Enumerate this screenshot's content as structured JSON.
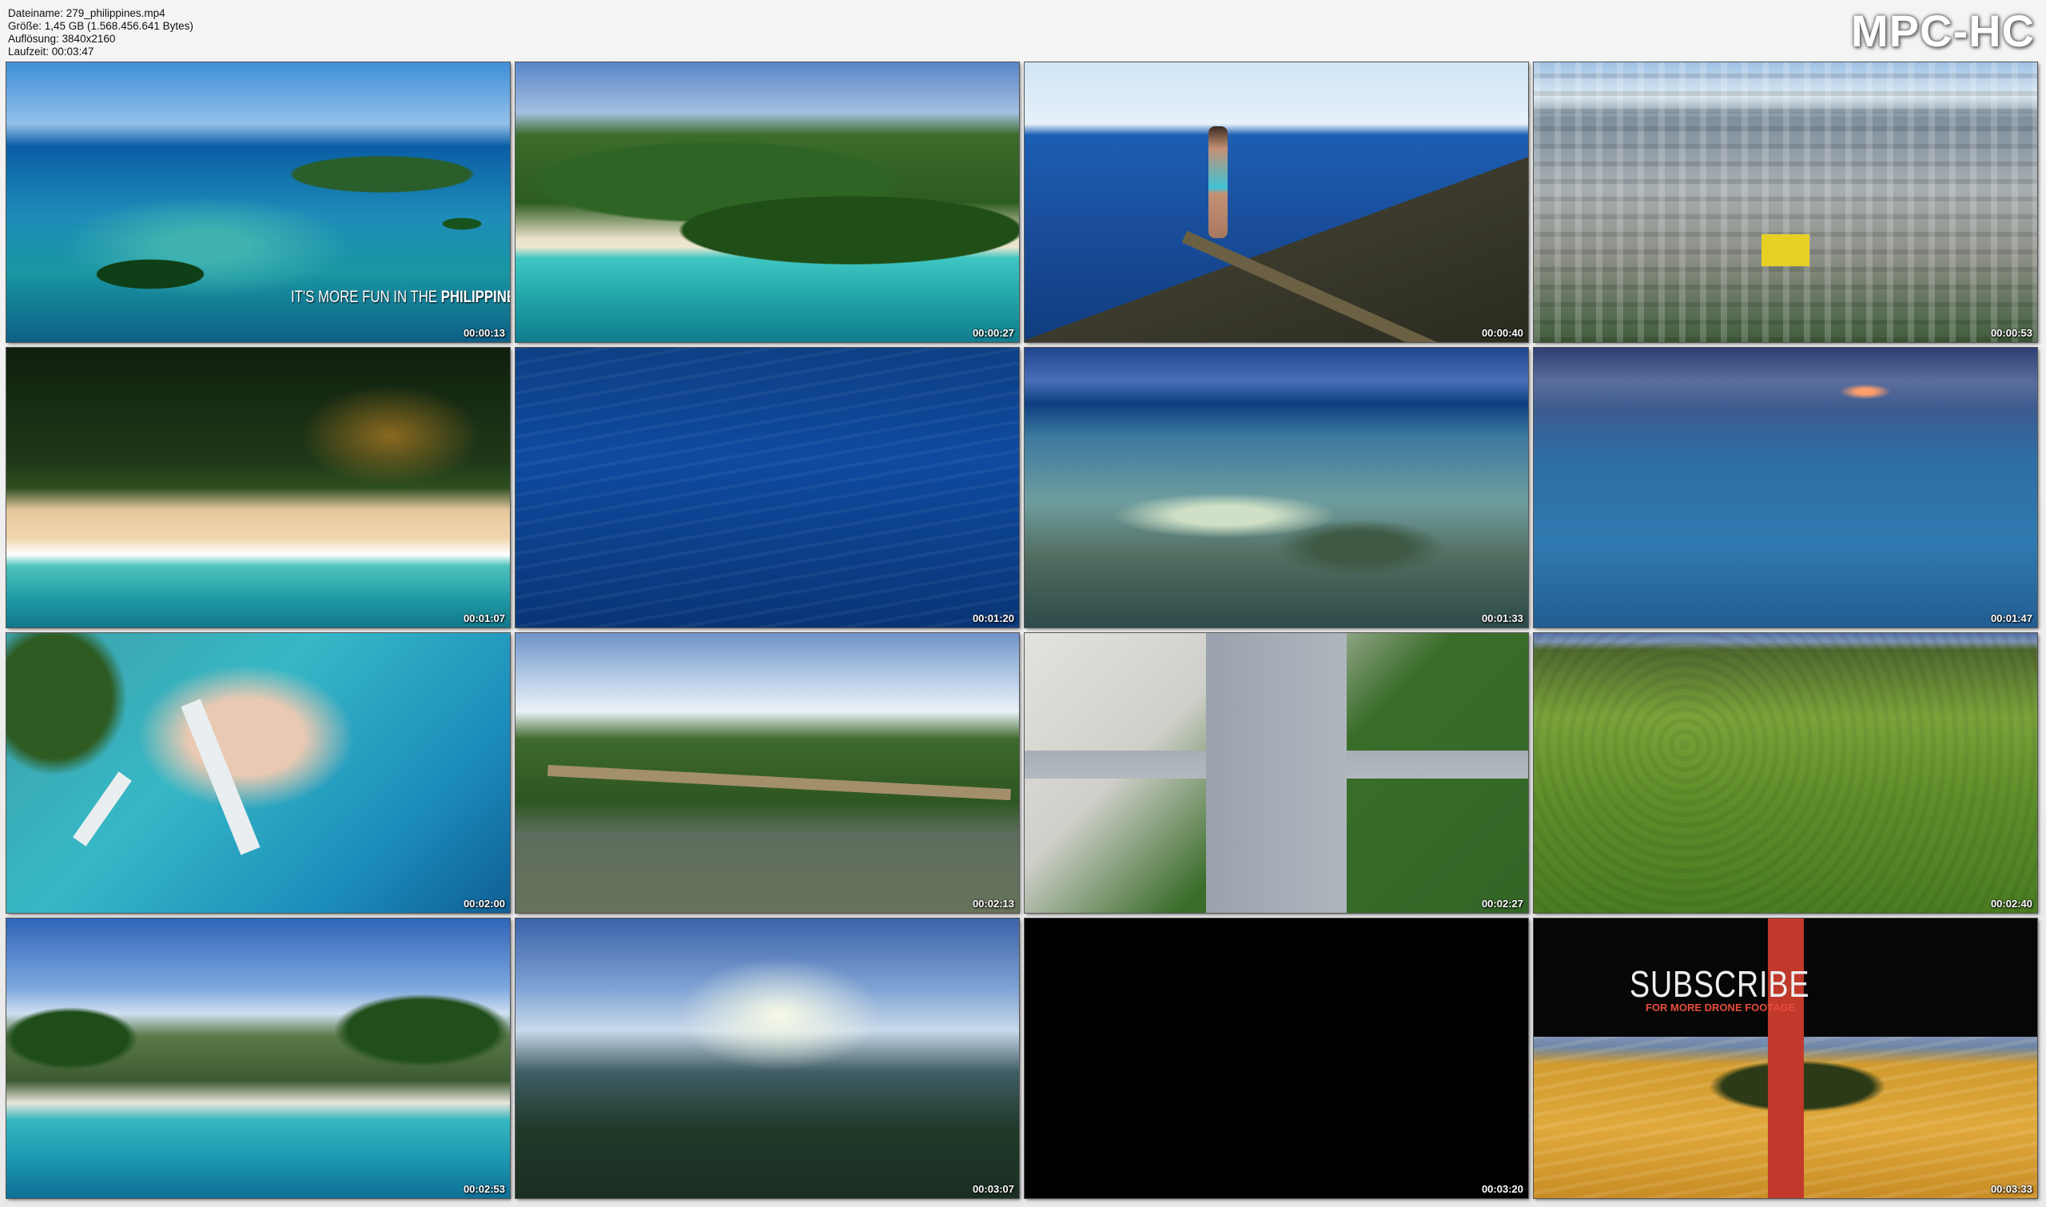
{
  "info": {
    "filename": "Dateiname: 279_philippines.mp4",
    "size": "Größe: 1,45 GB (1.568.456.641 Bytes)",
    "resolution": "Auflösung: 3840x2160",
    "duration": "Laufzeit: 00:03:47"
  },
  "logo": "MPC-HC",
  "overlays": {
    "tagline_prefix": "IT'S MORE FUN IN THE",
    "tagline_strong": "PHILIPPINES",
    "subscribe_title": "SUBSCRIBE",
    "subscribe_small": "FOR MORE DRONE FOOTAGE"
  },
  "thumbnails": [
    {
      "timestamp": "00:00:13",
      "scene": "coastline-island"
    },
    {
      "timestamp": "00:00:27",
      "scene": "beach-hill"
    },
    {
      "timestamp": "00:00:40",
      "scene": "cliff-diver"
    },
    {
      "timestamp": "00:00:53",
      "scene": "city"
    },
    {
      "timestamp": "00:01:07",
      "scene": "beach-top"
    },
    {
      "timestamp": "00:01:20",
      "scene": "deep-ocean"
    },
    {
      "timestamp": "00:01:33",
      "scene": "reef"
    },
    {
      "timestamp": "00:01:47",
      "scene": "sailboats"
    },
    {
      "timestamp": "00:02:00",
      "scene": "boats-shore"
    },
    {
      "timestamp": "00:02:13",
      "scene": "bamboo-bridge"
    },
    {
      "timestamp": "00:02:27",
      "scene": "intersection"
    },
    {
      "timestamp": "00:02:40",
      "scene": "forest"
    },
    {
      "timestamp": "00:02:53",
      "scene": "beach-resort"
    },
    {
      "timestamp": "00:03:07",
      "scene": "sunset-bay"
    },
    {
      "timestamp": "00:03:20",
      "scene": "black"
    },
    {
      "timestamp": "00:03:33",
      "scene": "subscribe"
    }
  ]
}
